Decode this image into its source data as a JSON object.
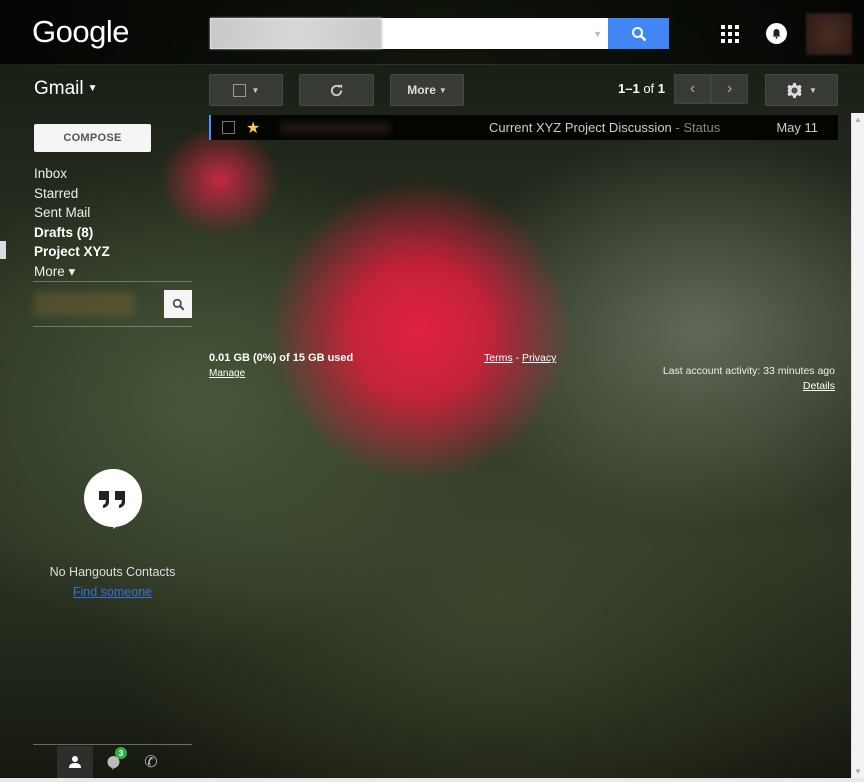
{
  "header": {
    "logo": "Google",
    "search": {
      "value": "",
      "placeholder": ""
    },
    "icons": {
      "search": "search-icon",
      "apps": "apps-grid-icon",
      "notifications": "notifications-icon"
    }
  },
  "toolbar": {
    "app_label": "Gmail",
    "more_label": "More",
    "pager": {
      "range": "1–1",
      "of": "of",
      "total": "1"
    }
  },
  "sidebar": {
    "compose_label": "COMPOSE",
    "items": [
      {
        "label": "Inbox",
        "bold": false
      },
      {
        "label": "Starred",
        "bold": false
      },
      {
        "label": "Sent Mail",
        "bold": false
      },
      {
        "label": "Drafts (8)",
        "bold": true
      },
      {
        "label": "Project XYZ",
        "bold": true
      },
      {
        "label": "More ▾",
        "bold": false
      }
    ]
  },
  "messages": [
    {
      "subject": "Current XYZ Project Discussion",
      "snippet": " - Status",
      "date": "May 11",
      "starred": true
    }
  ],
  "footer": {
    "storage": "0.01 GB (0%) of 15 GB used",
    "manage": "Manage",
    "terms": "Terms",
    "separator": " - ",
    "privacy": "Privacy",
    "last_activity": "Last account activity: 33 minutes ago",
    "details": "Details"
  },
  "hangouts": {
    "empty_text": "No Hangouts Contacts",
    "find_link": "Find someone",
    "badge_count": "3"
  },
  "colors": {
    "accent": "#4285f4",
    "star": "#f7cb4d",
    "badge": "#2cb24a",
    "link": "#3b6fd8"
  }
}
